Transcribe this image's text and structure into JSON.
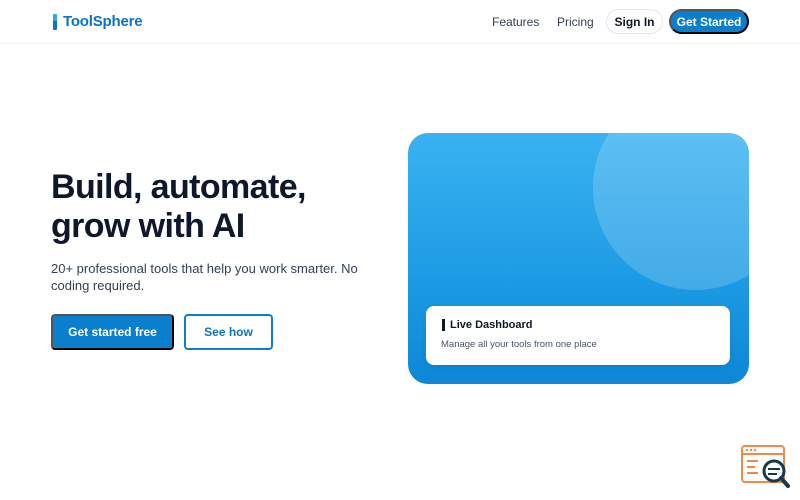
{
  "brand": {
    "name": "ToolSphere",
    "color": "#0a73c6"
  },
  "nav": {
    "links": [
      "Features",
      "Pricing"
    ],
    "sign_in": "Sign In",
    "get_started": "Get Started"
  },
  "hero": {
    "title": "Build, automate, grow with AI",
    "subtitle": "20+ professional tools that help you work smarter. No coding required.",
    "primary_cta": "Get started free",
    "secondary_cta": "See how"
  },
  "showcase": {
    "card_title": "Live Dashboard",
    "card_subtitle": "Manage all your tools from one place",
    "gradient_colors": [
      "#39b2f0",
      "#0d87d6"
    ]
  },
  "icons": {
    "logo": "logo-bar-icon",
    "dashboard": "dashboard-bar-icon",
    "corner": "code-search-icon"
  },
  "colors": {
    "primary": "#0a7fce",
    "heading": "#0f172a",
    "body": "#334155",
    "corner_widget": "#f08a4b"
  }
}
